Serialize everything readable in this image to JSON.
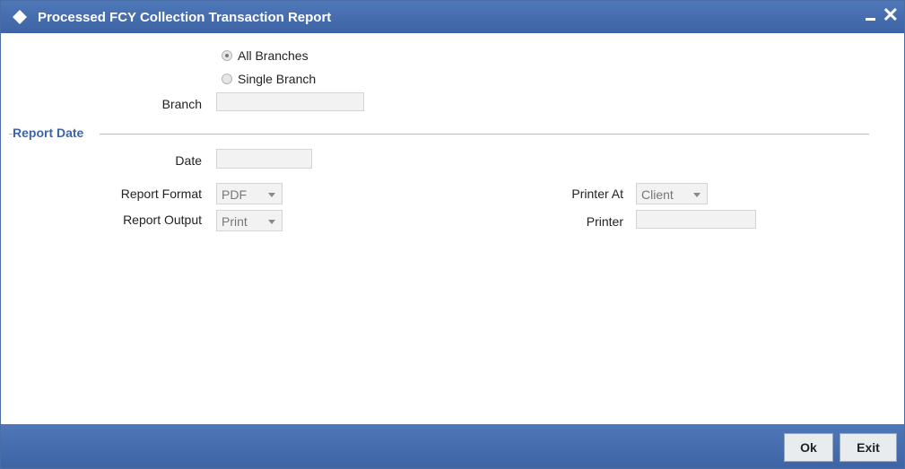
{
  "window": {
    "title": "Processed FCY Collection Transaction Report",
    "close_glyph": "✕"
  },
  "branch_selection": {
    "options": [
      {
        "label": "All Branches",
        "checked": true
      },
      {
        "label": "Single Branch",
        "checked": false
      }
    ],
    "branch_label": "Branch",
    "branch_value": ""
  },
  "report_date": {
    "section_title": "Report Date",
    "date_label": "Date",
    "date_value": ""
  },
  "report": {
    "format_label": "Report Format",
    "format_value": "PDF",
    "output_label": "Report Output",
    "output_value": "Print",
    "printer_at_label": "Printer At",
    "printer_at_value": "Client",
    "printer_label": "Printer",
    "printer_value": ""
  },
  "footer": {
    "ok_label": "Ok",
    "exit_label": "Exit"
  },
  "colors": {
    "titlebar": "#3d64a4",
    "section_title": "#3f63a6"
  }
}
